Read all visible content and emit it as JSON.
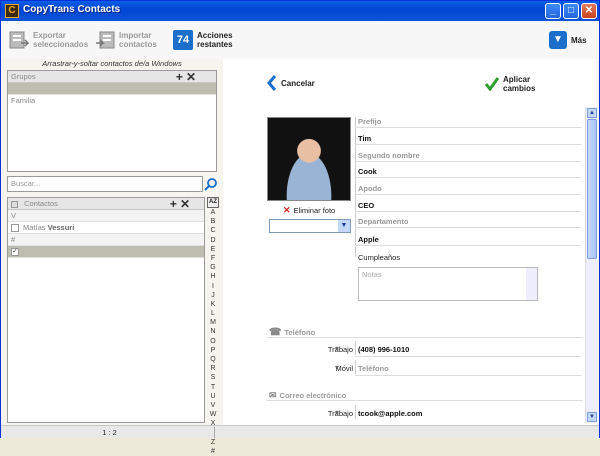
{
  "window": {
    "title": "CopyTrans Contacts",
    "app_icon": "C"
  },
  "toolbar": {
    "export_label": "Exportar seleccionados",
    "export_l1": "Exportar",
    "export_l2": "seleccionados",
    "import_l1": "Importar",
    "import_l2": "contactos",
    "pending_count": "74",
    "pending_l1": "Acciones",
    "pending_l2": "restantes",
    "more_label": "Más"
  },
  "left": {
    "drag_hint": "Arrastrar-y-soltar contactos de/a Windows",
    "groups_header": "Grupos",
    "groups": [
      "",
      "Familia"
    ],
    "search_placeholder": "Buscar...",
    "contacts_header": "Contactos",
    "contacts": [
      {
        "section": "V"
      },
      {
        "first": "Matías",
        "last": "Vessuri"
      },
      {
        "section": "#"
      },
      {
        "first": "",
        "last": ""
      }
    ],
    "az_button": "AZ",
    "letters": [
      "A",
      "B",
      "C",
      "D",
      "E",
      "F",
      "G",
      "H",
      "I",
      "J",
      "K",
      "L",
      "M",
      "N",
      "O",
      "P",
      "Q",
      "R",
      "S",
      "T",
      "U",
      "V",
      "W",
      "X",
      "Y",
      "Z",
      "#"
    ]
  },
  "status": {
    "count": "1 : 2"
  },
  "editor": {
    "cancel_label": "Cancelar",
    "apply_l1": "Aplicar",
    "apply_l2": "cambios",
    "delete_photo_label": "Eliminar foto",
    "prefix_label": "Prefijo",
    "first_name": "Tim",
    "middle_label": "Segundo nombre",
    "last_name": "Cook",
    "nickname_label": "Apodo",
    "job_title": "CEO",
    "department_label": "Departamento",
    "company": "Apple",
    "birthday_label": "Cumpleaños",
    "notes_placeholder": "Notas",
    "phone_section": "Teléfono",
    "phone_work_type": "Trabajo",
    "phone_work_value": "(408) 996-1010",
    "phone_mobile_type": "Móvil",
    "phone_mobile_placeholder": "Teléfono",
    "email_section": "Correo electrónico",
    "email_work_type": "Trabajo",
    "email_work_value": "tcook@apple.com"
  }
}
